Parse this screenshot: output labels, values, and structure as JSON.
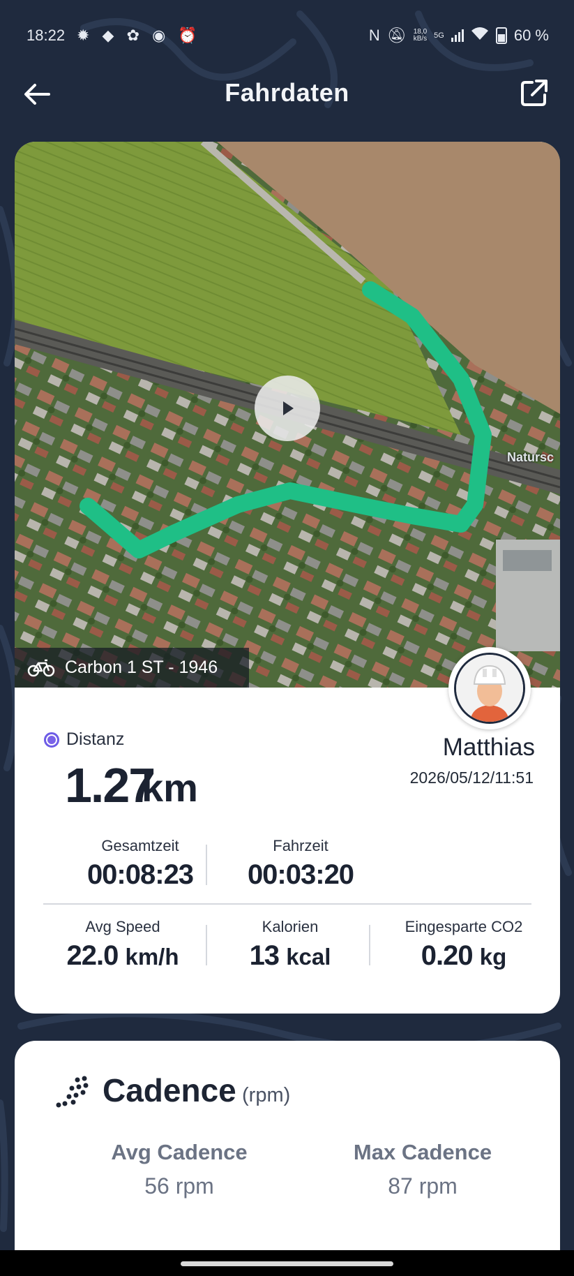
{
  "status_bar": {
    "time": "18:22",
    "network_rate_value": "18,0",
    "network_rate_unit": "kB/s",
    "network_type": "5G",
    "battery": "60 %"
  },
  "header": {
    "title": "Fahrdaten"
  },
  "map": {
    "bike_name": "Carbon 1 ST - 1946",
    "place_label": "Natursc"
  },
  "ride": {
    "distance_label": "Distanz",
    "distance_value": "1.27",
    "distance_unit": "km",
    "rider_name": "Matthias",
    "date_time": "2026/05/12/11:51"
  },
  "stats": {
    "total_time_label": "Gesamtzeit",
    "total_time_value": "00:08:23",
    "ride_time_label": "Fahrzeit",
    "ride_time_value": "00:03:20",
    "avg_speed_label": "Avg Speed",
    "avg_speed_value": "22.0",
    "avg_speed_unit": "km/h",
    "calories_label": "Kalorien",
    "calories_value": "13",
    "calories_unit": "kcal",
    "co2_label": "Eingesparte CO2",
    "co2_value": "0.20",
    "co2_unit": "kg"
  },
  "cadence": {
    "title": "Cadence",
    "unit": "(rpm)",
    "avg_label": "Avg Cadence",
    "avg_value": "56 rpm",
    "max_label": "Max Cadence",
    "max_value": "87 rpm"
  },
  "colors": {
    "background": "#1f2a3e",
    "route": "#1fbf86",
    "distance_accent": "#7a63e8",
    "card": "#ffffff"
  },
  "icons": [
    "back-arrow-icon",
    "share-icon",
    "play-icon",
    "bicycle-icon",
    "avatar-helmet-icon",
    "cadence-dots-icon",
    "radio-dot-icon"
  ]
}
